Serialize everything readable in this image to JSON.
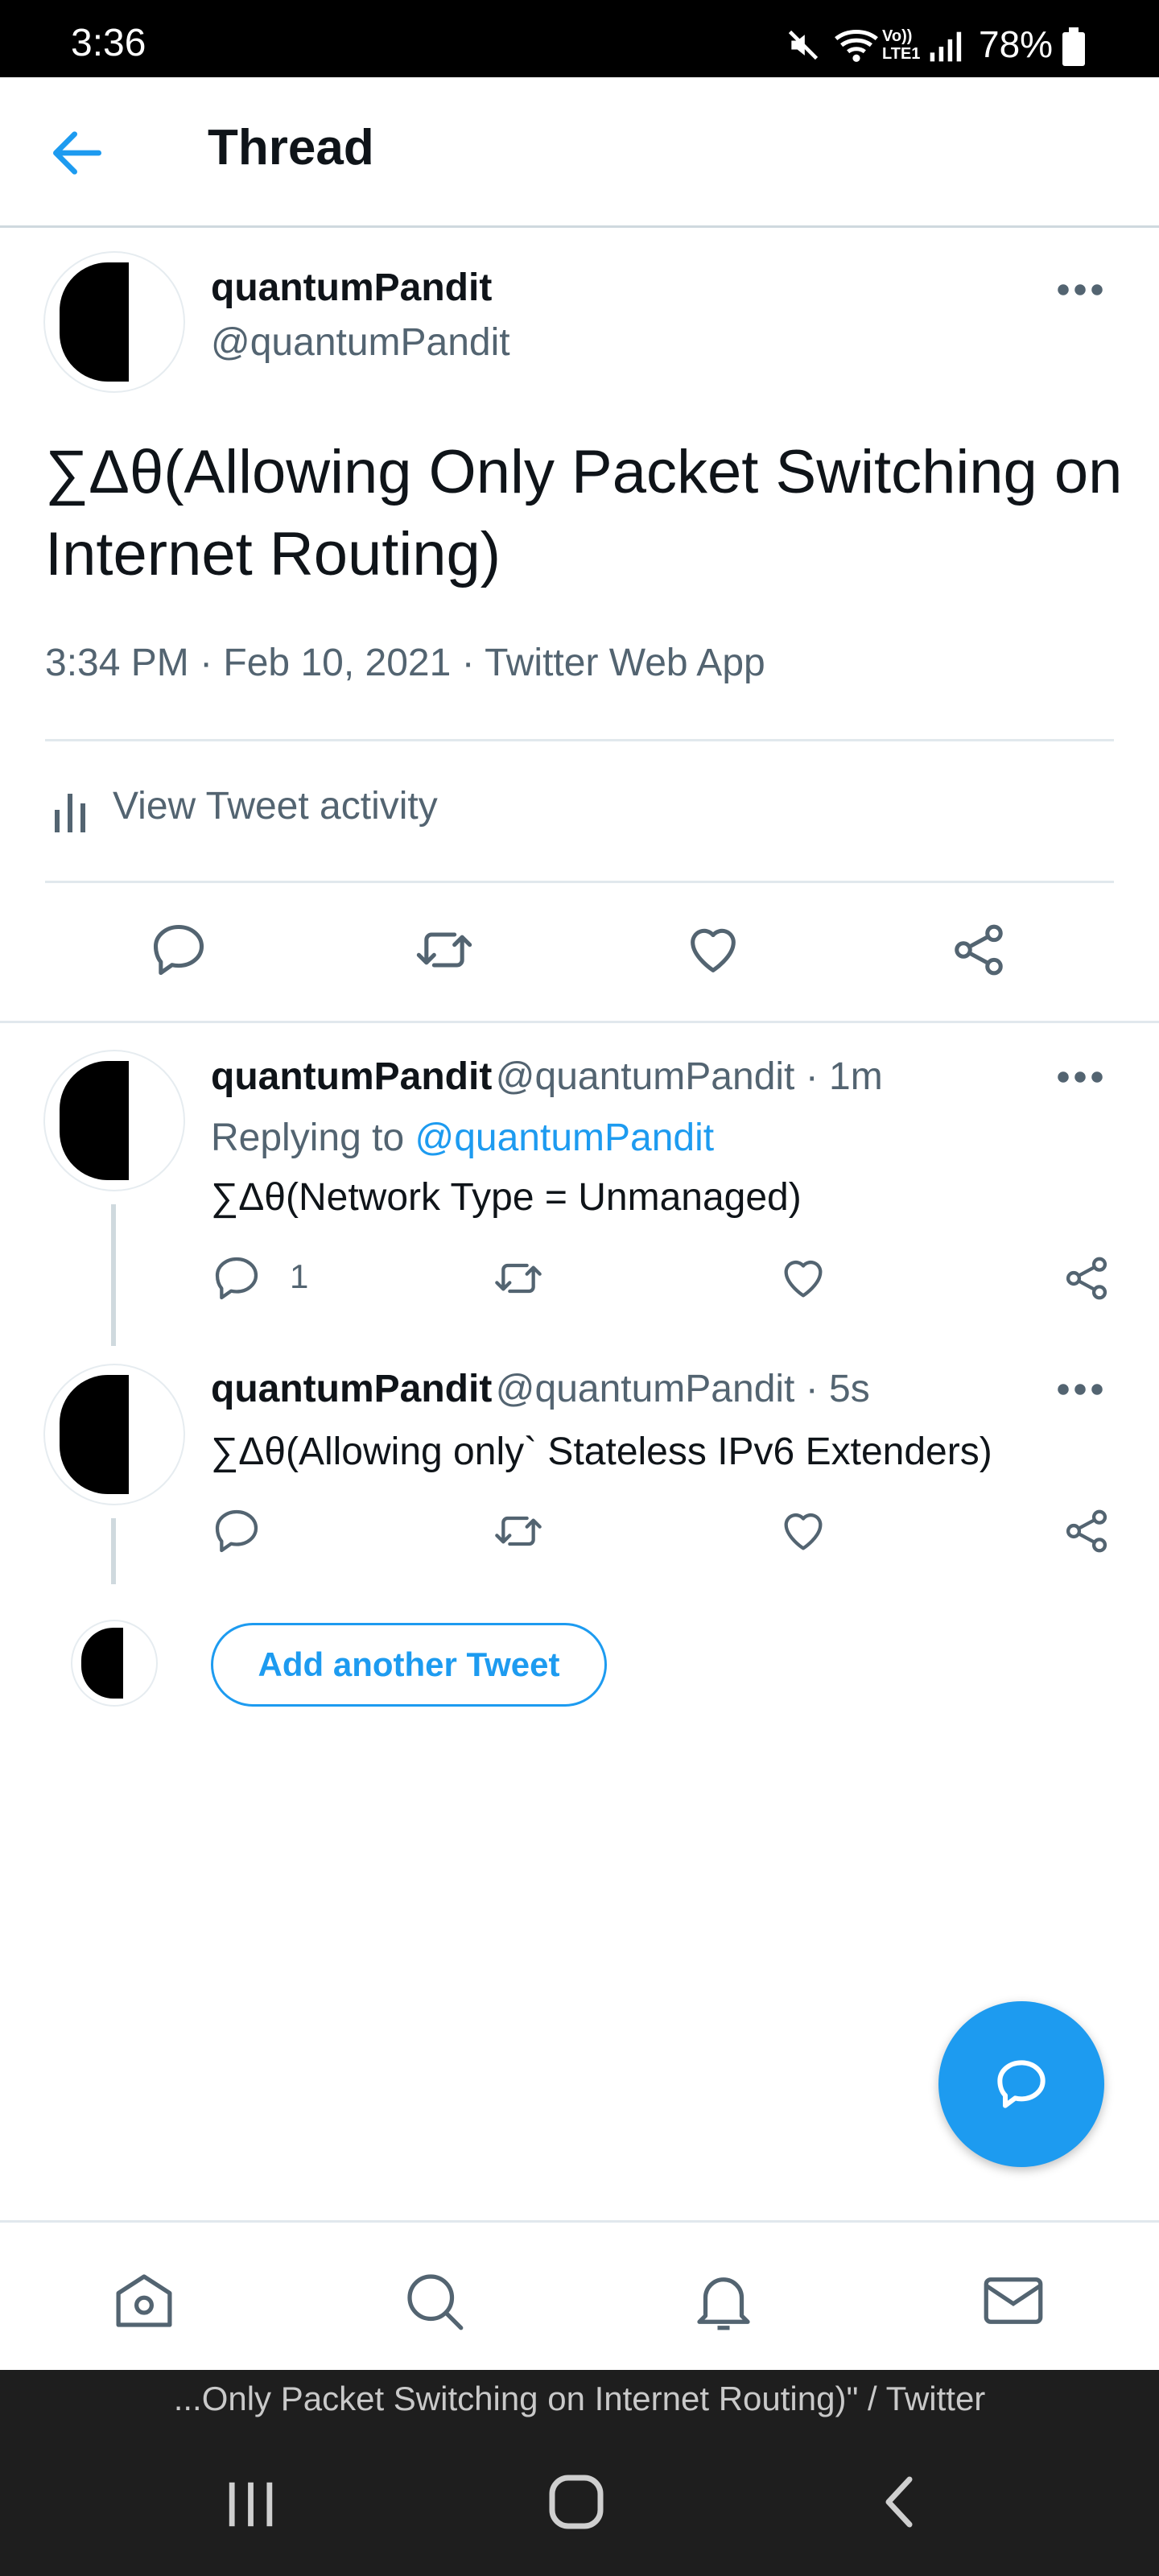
{
  "status_bar": {
    "time": "3:36",
    "battery": "78%"
  },
  "header": {
    "title": "Thread"
  },
  "main_tweet": {
    "name": "quantumPandit",
    "handle": "@quantumPandit",
    "text": "∑Δθ(Allowing Only Packet Switching on Internet Routing)",
    "meta": "3:34 PM · Feb 10, 2021 · Twitter Web App",
    "activity_label": "View Tweet activity"
  },
  "replies": [
    {
      "name": "quantumPandit",
      "handle_time": "@quantumPandit · 1m",
      "replying_prefix": "Replying to ",
      "replying_handle": "@quantumPandit",
      "text": "∑Δθ(Network Type = Unmanaged)",
      "reply_count": "1"
    },
    {
      "name": "quantumPandit",
      "handle_time": "@quantumPandit · 5s",
      "text": "∑Δθ(Allowing only` Stateless IPv6 Extenders)"
    }
  ],
  "add_tweet_label": "Add another Tweet",
  "browser": {
    "page_title": "...Only Packet Switching on Internet Routing)\" / Twitter"
  },
  "icons": {
    "back": "arrow-left-icon",
    "more": "more-horizontal-icon",
    "reply": "reply-icon",
    "retweet": "retweet-icon",
    "like": "heart-icon",
    "share": "share-icon",
    "activity": "bar-chart-icon",
    "compose": "compose-icon",
    "home": "home-icon",
    "search": "search-icon",
    "notifications": "bell-icon",
    "messages": "mail-icon"
  },
  "colors": {
    "accent": "#1d9bf0",
    "text": "#0f1419",
    "secondary": "#536471"
  }
}
